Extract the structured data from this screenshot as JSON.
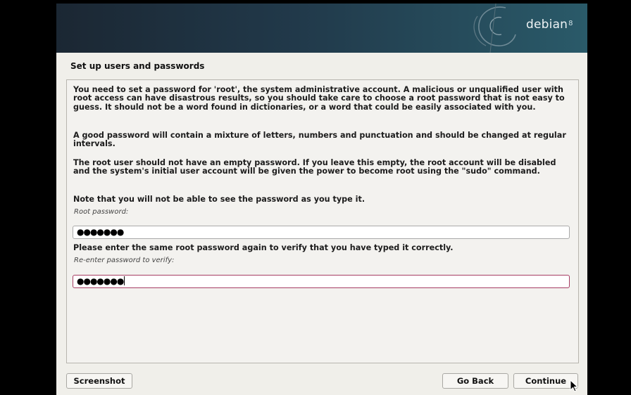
{
  "installer": {
    "brand": "debian",
    "version": "8"
  },
  "step_title": "Set up users and passwords",
  "paragraphs": {
    "p1": "You need to set a password for 'root', the system administrative account. A malicious or unqualified user with root access can have disastrous results, so you should take care to choose a root password that is not easy to guess. It should not be a word found in dictionaries, or a word that could be easily associated with you.",
    "p2": "A good password will contain a mixture of letters, numbers and punctuation and should be changed at regular intervals.",
    "p3": "The root user should not have an empty password. If you leave this empty, the root account will be disabled and the system's initial user account will be given the power to become root using the \"sudo\" command.",
    "p4": "Note that you will not be able to see the password as you type it.",
    "p5": "Please enter the same root password again to verify that you have typed it correctly."
  },
  "fields": {
    "root_password": {
      "label": "Root password:",
      "value": "●●●●●●●"
    },
    "verify_password": {
      "label": "Re-enter password to verify:",
      "value": "●●●●●●●"
    }
  },
  "buttons": {
    "screenshot": "Screenshot",
    "go_back": "Go Back",
    "continue": "Continue"
  },
  "colors": {
    "banner_start": "#1b2733",
    "banner_end": "#2a5a69",
    "focus_border": "#a63d63",
    "window_bg": "#f0efea"
  }
}
